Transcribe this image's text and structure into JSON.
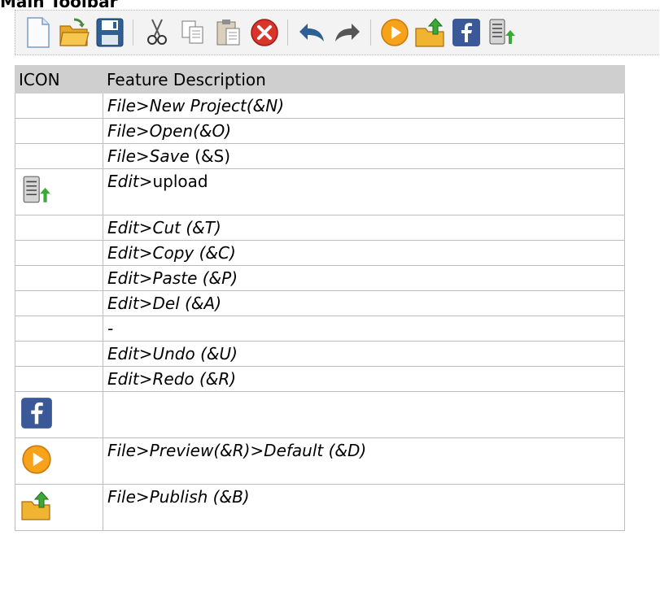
{
  "page": {
    "title": "Main Toolbar"
  },
  "toolbar": {
    "buttons": [
      {
        "icon": "new-document-icon"
      },
      {
        "icon": "open-folder-icon"
      },
      {
        "icon": "save-floppy-icon"
      },
      {
        "icon": "cut-scissors-icon"
      },
      {
        "icon": "copy-icon"
      },
      {
        "icon": "paste-clipboard-icon"
      },
      {
        "icon": "delete-red-x-icon"
      },
      {
        "icon": "undo-arrow-icon"
      },
      {
        "icon": "redo-arrow-icon"
      },
      {
        "icon": "preview-play-icon"
      },
      {
        "icon": "publish-folder-up-icon"
      },
      {
        "icon": "facebook-icon"
      },
      {
        "icon": "upload-server-icon"
      }
    ]
  },
  "table": {
    "headers": [
      "ICON",
      "Feature Description"
    ],
    "rows": [
      {
        "icon": "",
        "prefix": "",
        "italic": "File>New Project(&N)",
        "plain": ""
      },
      {
        "icon": "",
        "prefix": "",
        "italic": "File>Open(&O)",
        "plain": ""
      },
      {
        "icon": "",
        "prefix": "",
        "italic": "File>Save",
        "plain": " (&S)"
      },
      {
        "icon": "upload-server-icon",
        "prefix": "",
        "italic": "Edit>",
        "plain": "upload"
      },
      {
        "icon": "",
        "prefix": "",
        "italic": "Edit>Cut (&T)",
        "plain": ""
      },
      {
        "icon": "",
        "prefix": "",
        "italic": "Edit>Copy (&C)",
        "plain": ""
      },
      {
        "icon": "",
        "prefix": "",
        "italic": "Edit>Paste (&P)",
        "plain": ""
      },
      {
        "icon": "",
        "prefix": "",
        "italic": "Edit>Del (&A)",
        "plain": ""
      },
      {
        "icon": "",
        "prefix": "",
        "italic": "-",
        "plain": ""
      },
      {
        "icon": "",
        "prefix": "",
        "italic": "Edit>Undo (&U)",
        "plain": ""
      },
      {
        "icon": "",
        "prefix": "",
        "italic": "Edit>Redo (&R)",
        "plain": ""
      },
      {
        "icon": "facebook-icon",
        "prefix": "",
        "italic": "",
        "plain": ""
      },
      {
        "icon": "preview-play-icon",
        "prefix": "",
        "italic": "File>Preview(&R)>Default (&D)",
        "plain": ""
      },
      {
        "icon": "publish-folder-up-icon",
        "prefix": "",
        "italic": "File>Publish (&B)",
        "plain": ""
      }
    ]
  },
  "colors": {
    "header_bg": "#cfcfcf",
    "toolbar_bg": "#f3f3f3",
    "facebook_blue": "#3b5998",
    "preview_orange": "#f7a21b",
    "publish_green": "#3aa935",
    "delete_red": "#d9352c"
  }
}
